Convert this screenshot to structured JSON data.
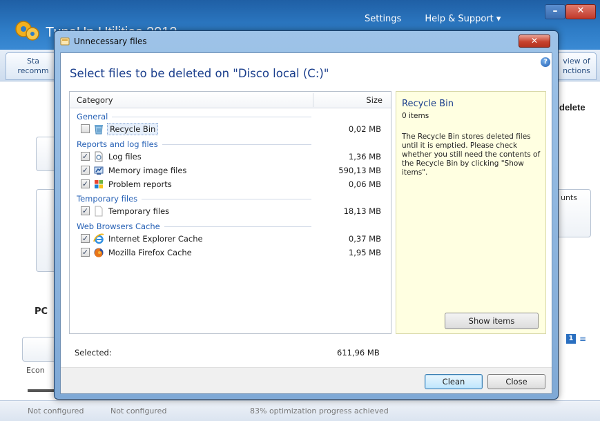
{
  "app": {
    "title": "TuneUp Utilities 2012",
    "top_links": {
      "settings": "Settings",
      "help": "Help & Support ▾"
    },
    "window_controls": {
      "minimize": "–",
      "close": "✕"
    },
    "tab_left": "Sta\nrecomm",
    "tab_right": "view of\nnctions",
    "right_heading": "delete",
    "right_box_label": "unts",
    "pc_label": "PC",
    "econ_label": "Econ",
    "pager": {
      "page1": "1",
      "page2": "≡"
    },
    "status": {
      "item1": "Not configured",
      "item2": "Not configured",
      "item3": "83% optimization progress achieved"
    }
  },
  "dialog": {
    "title": "Unnecessary files",
    "close": "✕",
    "help": "?",
    "heading": "Select files to be deleted on \"Disco local (C:)\"",
    "columns": {
      "category": "Category",
      "size": "Size"
    },
    "groups": [
      {
        "label": "General",
        "items": [
          {
            "name": "Recycle Bin",
            "size": "0,02 MB",
            "checked": false,
            "selected": true,
            "icon": "recycle-bin-icon"
          }
        ]
      },
      {
        "label": "Reports and log files",
        "items": [
          {
            "name": "Log files",
            "size": "1,36 MB",
            "checked": true,
            "icon": "log-file-icon"
          },
          {
            "name": "Memory image files",
            "size": "590,13 MB",
            "checked": true,
            "icon": "memory-image-icon"
          },
          {
            "name": "Problem reports",
            "size": "0,06 MB",
            "checked": true,
            "icon": "windows-flag-icon"
          }
        ]
      },
      {
        "label": "Temporary files",
        "items": [
          {
            "name": "Temporary files",
            "size": "18,13 MB",
            "checked": true,
            "icon": "blank-file-icon"
          }
        ]
      },
      {
        "label": "Web Browsers Cache",
        "items": [
          {
            "name": "Internet Explorer Cache",
            "size": "0,37 MB",
            "checked": true,
            "icon": "internet-explorer-icon"
          },
          {
            "name": "Mozilla Firefox Cache",
            "size": "1,95 MB",
            "checked": true,
            "icon": "firefox-icon"
          }
        ]
      }
    ],
    "selected_label": "Selected:",
    "selected_total": "611,96 MB",
    "info": {
      "title": "Recycle Bin",
      "count": "0 items",
      "description": "The Recycle Bin stores deleted files until it is emptied. Please check whether you still need the contents of the Recycle Bin by clicking \"Show items\".",
      "show_items": "Show items"
    },
    "buttons": {
      "clean": "Clean",
      "close": "Close"
    },
    "check_mark": "✓"
  }
}
